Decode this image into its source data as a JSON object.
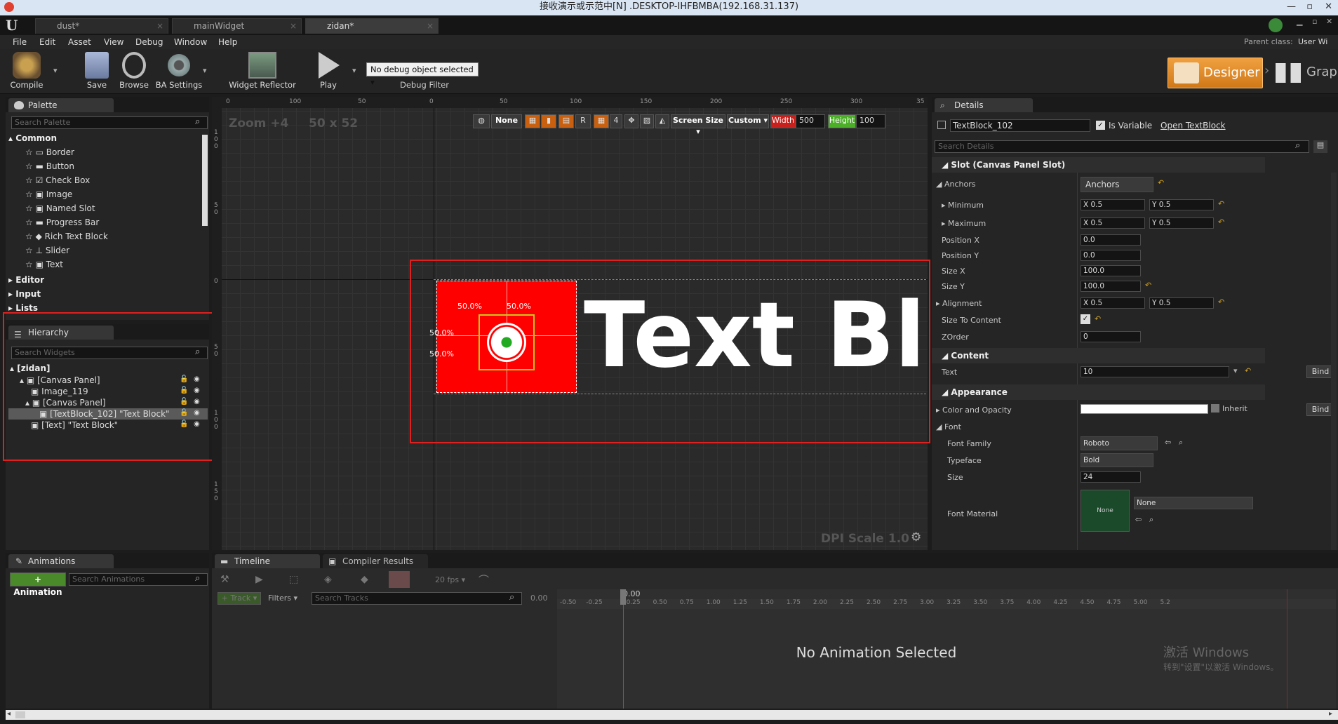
{
  "window": {
    "title": "接收演示或示范中[N] .DESKTOP-IHFBMBA(192.168.31.137)"
  },
  "tabs": [
    {
      "label": "dust*"
    },
    {
      "label": "mainWidget"
    },
    {
      "label": "zidan*"
    }
  ],
  "menu": [
    "File",
    "Edit",
    "Asset",
    "View",
    "Debug",
    "Window",
    "Help"
  ],
  "parent_class": {
    "label": "Parent class:",
    "value": "User Wi"
  },
  "toolbar": {
    "compile": "Compile",
    "save": "Save",
    "browse": "Browse",
    "ba_settings": "BA Settings",
    "widget_reflector": "Widget Reflector",
    "play": "Play",
    "debug_select": "No debug object selected ▾",
    "debug_filter": "Debug Filter",
    "designer": "Designer",
    "graph": "Grap"
  },
  "palette": {
    "tab": "Palette",
    "search_placeholder": "Search Palette",
    "common": "Common",
    "items": [
      "Border",
      "Button",
      "Check Box",
      "Image",
      "Named Slot",
      "Progress Bar",
      "Rich Text Block",
      "Slider",
      "Text"
    ],
    "categories": [
      "Editor",
      "Input",
      "Lists"
    ]
  },
  "hierarchy": {
    "tab": "Hierarchy",
    "search_placeholder": "Search Widgets",
    "root": "[zidan]",
    "items": [
      "[Canvas Panel]",
      "Image_119",
      "[Canvas Panel]",
      "[TextBlock_102] \"Text Block\"",
      "[Text] \"Text Block\""
    ]
  },
  "canvas": {
    "zoom": "Zoom +4",
    "size": "50 x 52",
    "ruler_top": [
      "0",
      "100",
      "50",
      "0",
      "50",
      "100",
      "150",
      "200",
      "250",
      "300",
      "35"
    ],
    "ruler_left": [
      "1",
      "0",
      "0",
      "5",
      "0",
      "0",
      "5",
      "0",
      "1",
      "0",
      "0",
      "1",
      "5",
      "0"
    ],
    "none_label": "None",
    "r_label": "R",
    "four_label": "4",
    "screen_size": "Screen Size ▾",
    "custom": "Custom ▾",
    "width_label": "Width",
    "width_value": "500",
    "height_label": "Height",
    "height_value": "100",
    "pct_top_left": "50.0%",
    "pct_top_right": "50.0%",
    "pct_left_top": "50.0%",
    "pct_left_bottom": "50.0%",
    "preview_text": "Text Bl",
    "dpi": "DPI Scale 1.0"
  },
  "details": {
    "tab": "Details",
    "name": "TextBlock_102",
    "is_variable": "Is Variable",
    "open_link": "Open TextBlock",
    "search_placeholder": "Search Details",
    "slot_section": "Slot (Canvas Panel Slot)",
    "anchors_label": "Anchors",
    "anchors_value": "Anchors",
    "minimum_label": "Minimum",
    "min_x": "X  0.5",
    "min_y": "Y  0.5",
    "maximum_label": "Maximum",
    "max_x": "X  0.5",
    "max_y": "Y  0.5",
    "position_x_label": "Position X",
    "position_x": "0.0",
    "position_y_label": "Position Y",
    "position_y": "0.0",
    "size_x_label": "Size X",
    "size_x": "100.0",
    "size_y_label": "Size Y",
    "size_y": "100.0",
    "alignment_label": "Alignment",
    "align_x": "X  0.5",
    "align_y": "Y  0.5",
    "size_to_content_label": "Size To Content",
    "zorder_label": "ZOrder",
    "zorder": "0",
    "content_section": "Content",
    "text_label": "Text",
    "text_value": "10",
    "bind": "Bind",
    "appearance_section": "Appearance",
    "color_label": "Color and Opacity",
    "inherit": "Inherit",
    "font_label": "Font",
    "font_family_label": "Font Family",
    "font_family": "Roboto",
    "typeface_label": "Typeface",
    "typeface": "Bold",
    "size_label": "Size",
    "size": "24",
    "font_material_label": "Font Material",
    "font_material_thumb": "None",
    "font_material": "None"
  },
  "animations": {
    "tab": "Animations",
    "add_button": "+ Animation",
    "search_placeholder": "Search Animations"
  },
  "timeline": {
    "tab": "Timeline",
    "compiler_tab": "Compiler Results",
    "fps": "20 fps ▾",
    "track_button": "+ Track ▾",
    "filters": "Filters ▾",
    "search_placeholder": "Search Tracks",
    "time": "0.00",
    "scrub_time": "0.00",
    "ticks": [
      "-0.50",
      "-0.25",
      "0.25",
      "0.50",
      "0.75",
      "1.00",
      "1.25",
      "1.50",
      "1.75",
      "2.00",
      "2.25",
      "2.50",
      "2.75",
      "3.00",
      "3.25",
      "3.50",
      "3.75",
      "4.00",
      "4.25",
      "4.50",
      "4.75",
      "5.00",
      "5.2"
    ],
    "empty": "No Animation Selected"
  },
  "watermark": {
    "line1": "激活 Windows",
    "line2": "转到\"设置\"以激活 Windows。"
  },
  "colors": {
    "accent": "#e8a030",
    "selection_red": "#e02020",
    "widget_red": "#ff0000",
    "green": "#4caf28",
    "width_red": "#c8201c"
  }
}
